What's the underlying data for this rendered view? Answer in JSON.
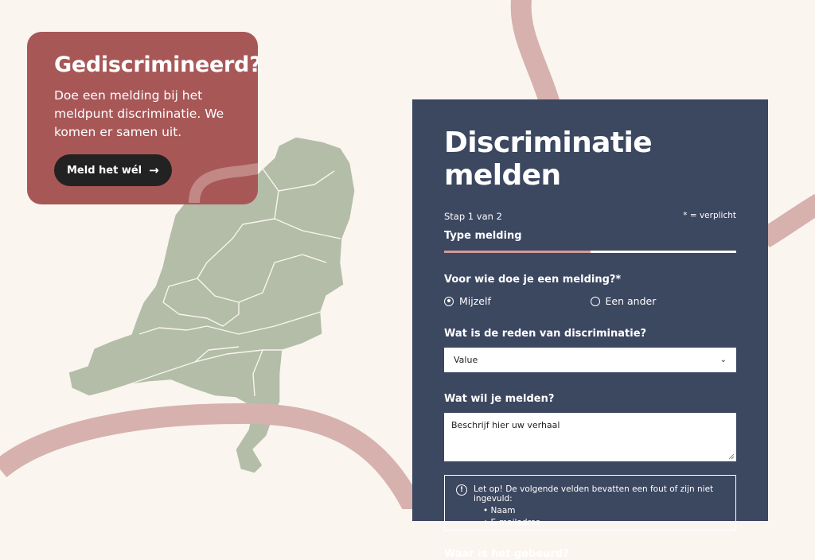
{
  "cta": {
    "title": "Gediscrimineerd?",
    "text": "Doe een melding bij het meldpunt discriminatie. We komen er samen uit.",
    "button_label": "Meld het wél",
    "button_icon": "arrow-right-icon"
  },
  "form": {
    "title": "Discriminatie melden",
    "step_text": "Stap 1 van 2",
    "required_note": "* = verplicht",
    "step_name": "Type melding",
    "progress": 0.5,
    "q_who": "Voor wie doe je een melding?*",
    "radio_options": [
      "Mijzelf",
      "Een ander"
    ],
    "radio_selected": "Mijzelf",
    "q_reason": "Wat is de reden van discriminatie?",
    "select_value": "Value",
    "q_report": "Wat wil je melden?",
    "textarea_placeholder": "Beschrijf hier uw verhaal",
    "alert_text": "Let op! De volgende velden bevatten een fout of zijn niet ingevuld:",
    "alert_items": [
      "Naam",
      "E-mailadres"
    ],
    "q_where": "Waar is het gebeurd?"
  },
  "colors": {
    "background": "#faf5ef",
    "card": "#a85757",
    "panel": "#3c4760",
    "map": "#b3bda8",
    "ribbon": "#d7b1ad"
  }
}
